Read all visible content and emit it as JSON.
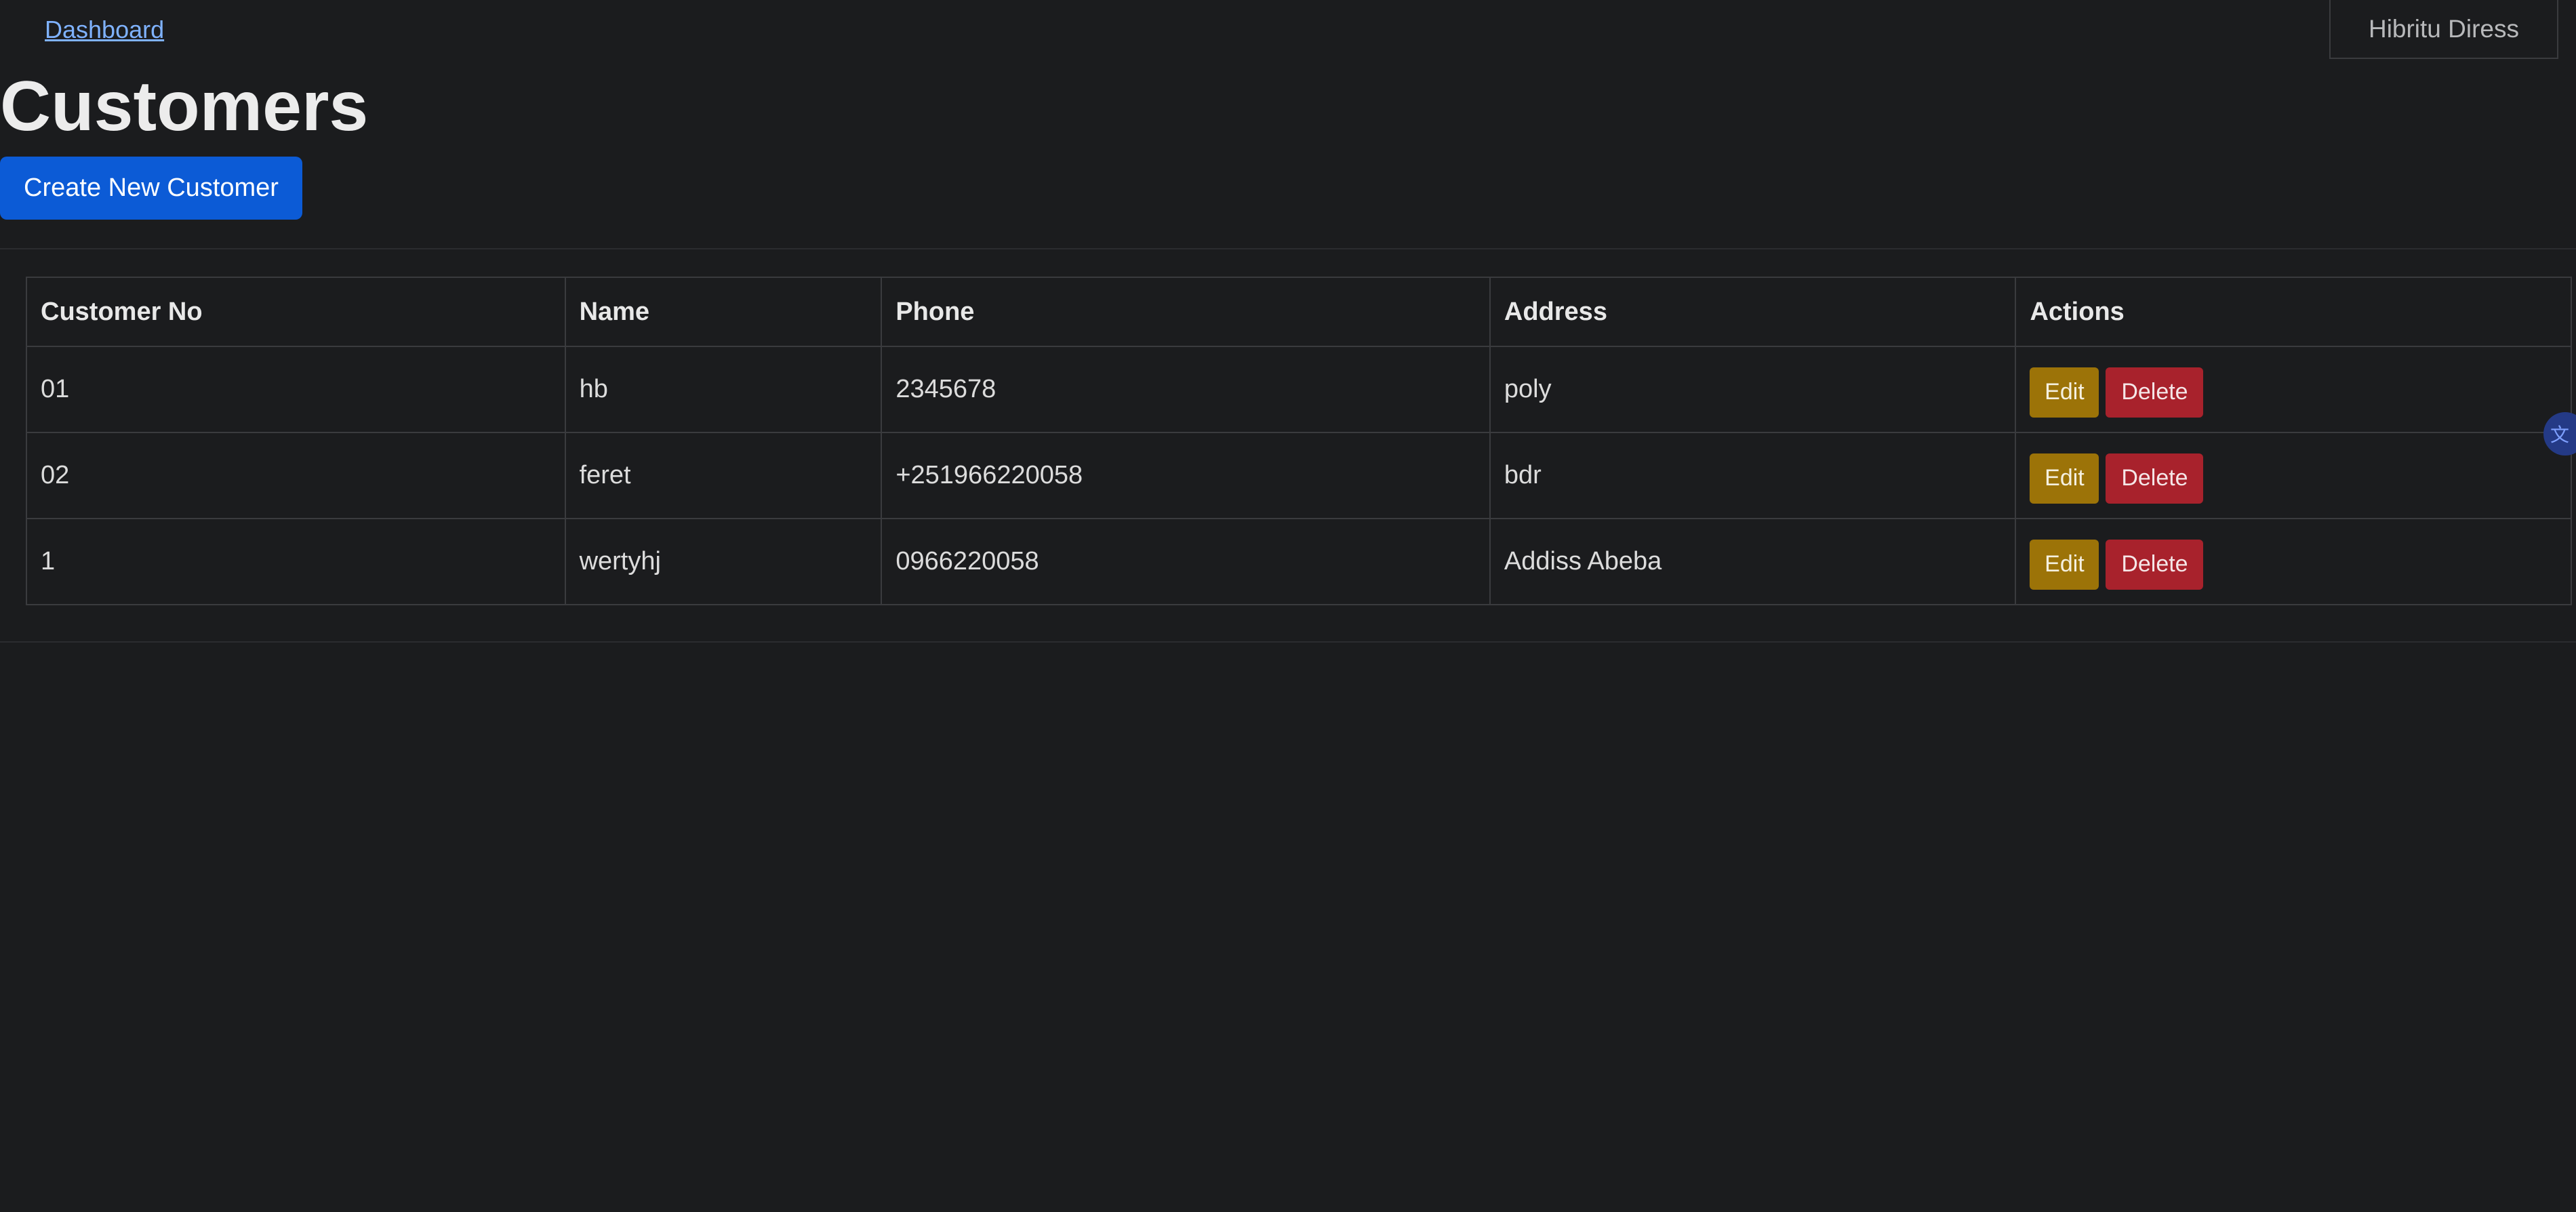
{
  "nav": {
    "dashboard_link": "Dashboard"
  },
  "user": {
    "name": "Hibritu Diress"
  },
  "page": {
    "title": "Customers",
    "create_button": "Create New Customer"
  },
  "table": {
    "columns": [
      "Customer No",
      "Name",
      "Phone",
      "Address",
      "Actions"
    ],
    "rows": [
      {
        "customer_no": "01",
        "name": "hb",
        "phone": "2345678",
        "address": "poly"
      },
      {
        "customer_no": "02",
        "name": "feret",
        "phone": "+251966220058",
        "address": "bdr"
      },
      {
        "customer_no": "1",
        "name": "wertyhj",
        "phone": "0966220058",
        "address": "Addiss Abeba"
      }
    ],
    "edit_label": "Edit",
    "delete_label": "Delete"
  },
  "icons": {
    "translate": "translate-icon"
  },
  "colors": {
    "background": "#1b1c1e",
    "primary": "#0c5bd6",
    "warning": "#9c7308",
    "danger": "#a8222c",
    "link": "#7fb2ff"
  }
}
